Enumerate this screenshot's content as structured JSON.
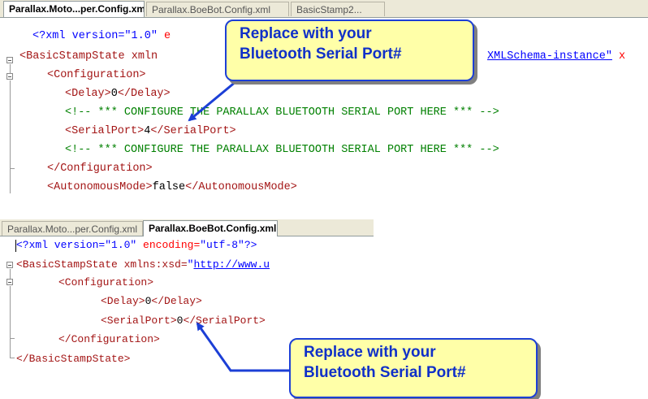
{
  "top": {
    "tabs": [
      {
        "label": "Parallax.Moto...per.Config.xml",
        "active": true
      },
      {
        "label": "Parallax.BoeBot.Config.xml",
        "active": false
      },
      {
        "label": "BasicStamp2...",
        "active": false
      }
    ],
    "lines": [
      {
        "t1": "<?xml version=",
        "t2": "\"1.0\"",
        "t3": " e"
      },
      {
        "t1": "<BasicStampState xmln",
        "t2": "XMLSchema-instance\"",
        "t3": " x"
      },
      {
        "t1": "<Configuration>"
      },
      {
        "t1": "<Delay>",
        "t2": "0",
        "t3": "</Delay>"
      },
      {
        "t1": "<!-- *** CONFIGURE THE PARALLAX BLUETOOTH SERIAL PORT HERE *** -->"
      },
      {
        "t1": "<SerialPort>",
        "t2": "4",
        "t3": "</SerialPort>"
      },
      {
        "t1": "<!-- *** CONFIGURE THE PARALLAX BLUETOOTH SERIAL PORT HERE *** -->"
      },
      {
        "t1": "</Configuration>"
      },
      {
        "t1": "<AutonomousMode>",
        "t2": "false",
        "t3": "</AutonomousMode>"
      }
    ],
    "callout": {
      "line1": "Replace with your",
      "line2": "Bluetooth Serial Port#"
    }
  },
  "bottom": {
    "tabs": [
      {
        "label": "Parallax.Moto...per.Config.xml",
        "active": false
      },
      {
        "label": "Parallax.BoeBot.Config.xml",
        "active": true
      }
    ],
    "lines": [
      {
        "t1": "<?xml version=",
        "t2": "\"1.0\"",
        "t3": " encoding=",
        "t4": "\"utf-8\"",
        "t5": "?>"
      },
      {
        "t1": "<BasicStampState xmlns:xsd=",
        "t2": "\"",
        "t3": "http://www.u"
      },
      {
        "t1": "<Configuration>"
      },
      {
        "t1": "<Delay>",
        "t2": "0",
        "t3": "</Delay>"
      },
      {
        "t1": "<SerialPort>",
        "t2": "0",
        "t3": "</SerialPort>"
      },
      {
        "t1": "</Configuration>"
      },
      {
        "t1": "</BasicStampState>"
      }
    ],
    "callout": {
      "line1": "Replace with your",
      "line2": "Bluetooth Serial Port#"
    }
  },
  "colors": {
    "callout_bg": "#ffffa8",
    "callout_border": "#1c3fd6",
    "arrow": "#1c3fd6",
    "comment": "#008000",
    "tag": "#a31515"
  }
}
